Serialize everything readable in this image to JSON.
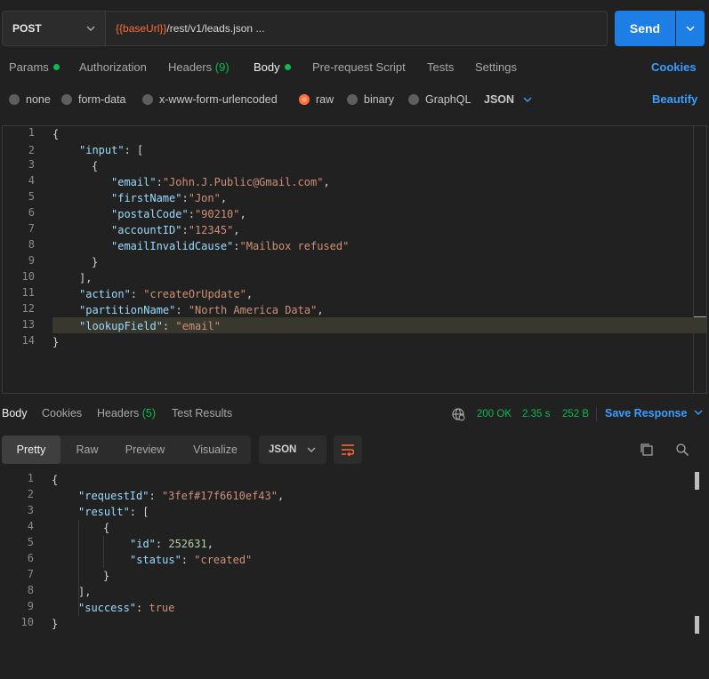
{
  "request": {
    "method": "POST",
    "url_var": "{{baseUrl}}",
    "url_path": "/rest/v1/leads.json ...",
    "send_label": "Send"
  },
  "request_tabs": {
    "params": "Params",
    "authorization": "Authorization",
    "headers": "Headers",
    "headers_count": "(9)",
    "body": "Body",
    "prerequest": "Pre-request Script",
    "tests": "Tests",
    "settings": "Settings",
    "cookies": "Cookies"
  },
  "body_types": {
    "none": "none",
    "form_data": "form-data",
    "urlencoded": "x-www-form-urlencoded",
    "raw": "raw",
    "binary": "binary",
    "graphql": "GraphQL",
    "format": "JSON",
    "beautify": "Beautify",
    "selected": "raw"
  },
  "request_body": {
    "line_numbers": [
      "1",
      "2",
      "3",
      "4",
      "5",
      "6",
      "7",
      "8",
      "9",
      "10",
      "11",
      "12",
      "13",
      "14"
    ],
    "l1": "{",
    "l2_key": "\"input\"",
    "l2_rest": ": [",
    "l3": "{",
    "email_key": "\"email\"",
    "email_val": "\"John.J.Public@Gmail.com\"",
    "first_key": "\"firstName\"",
    "first_val": "\"Jon\"",
    "postal_key": "\"postalCode\"",
    "postal_val": "\"90210\"",
    "account_key": "\"accountID\"",
    "account_val": "\"12345\"",
    "cause_key": "\"emailInvalidCause\"",
    "cause_val": "\"Mailbox refused\"",
    "l9": "}",
    "l10": "],",
    "action_key": "\"action\"",
    "action_val": "\"createOrUpdate\"",
    "partition_key": "\"partitionName\"",
    "partition_val": "\"North America Data\"",
    "lookup_key": "\"lookupField\"",
    "lookup_val": "\"email\"",
    "l14": "}"
  },
  "response_tabs": {
    "body": "Body",
    "cookies": "Cookies",
    "headers": "Headers",
    "headers_count": "(5)",
    "test_results": "Test Results",
    "status": "200 OK",
    "time": "2.35 s",
    "size": "252 B",
    "save": "Save Response"
  },
  "response_view": {
    "pretty": "Pretty",
    "raw": "Raw",
    "preview": "Preview",
    "visualize": "Visualize",
    "format": "JSON"
  },
  "response_body": {
    "line_numbers": [
      "1",
      "2",
      "3",
      "4",
      "5",
      "6",
      "7",
      "8",
      "9",
      "10"
    ],
    "l1": "{",
    "req_key": "\"requestId\"",
    "req_val": "\"3fef#17f6610ef43\"",
    "result_key": "\"result\"",
    "result_rest": ": [",
    "l4": "{",
    "id_key": "\"id\"",
    "id_val": "252631",
    "status_key": "\"status\"",
    "status_val": "\"created\"",
    "l7": "}",
    "l8": "],",
    "success_key": "\"success\"",
    "success_val": "true",
    "l10": "}"
  },
  "colors": {
    "accent": "#ff6c37",
    "send": "#1d7ee6",
    "status_ok": "#0cbb52",
    "link": "#3b9eff"
  }
}
